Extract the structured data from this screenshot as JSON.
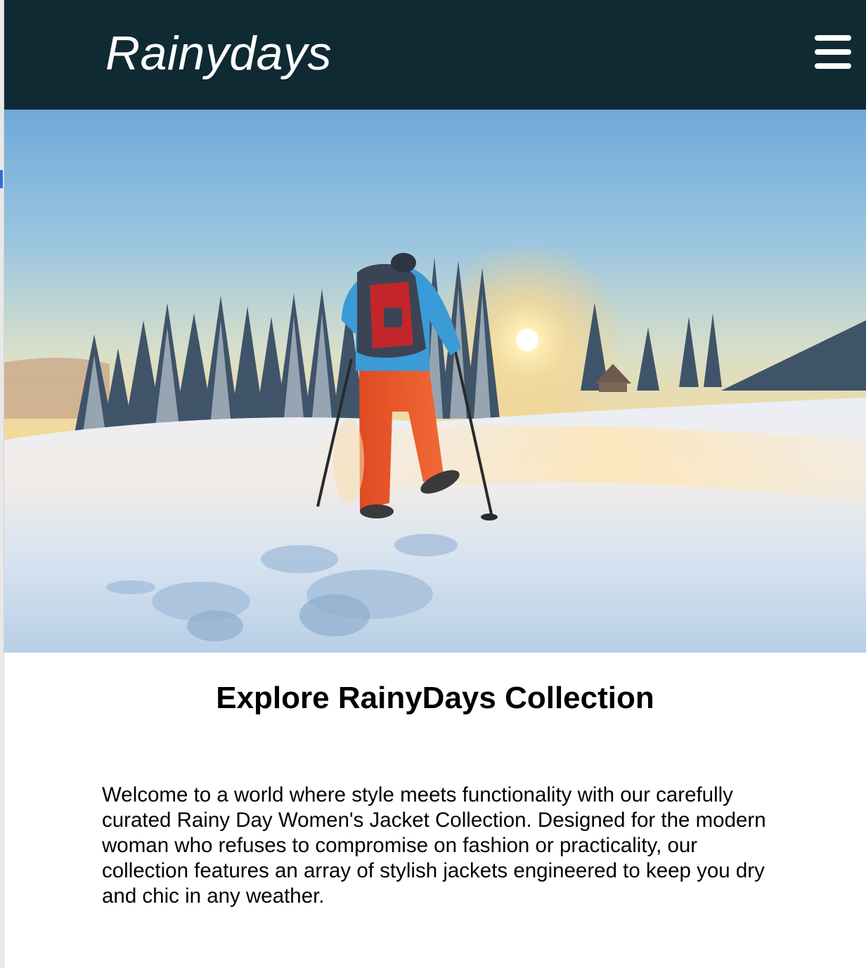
{
  "header": {
    "logo_text": "Rainydays",
    "menu_icon": "hamburger-menu-icon",
    "background_color": "#0f2a33"
  },
  "hero": {
    "subject": "snowshoe-hiker-photo"
  },
  "main": {
    "heading": "Explore RainyDays Collection",
    "intro": "Welcome to a world where style meets functionality with our carefully curated Rainy Day Women's Jacket Collection. Designed for the modern woman who refuses to compromise on fashion or practicality, our collection features an array of stylish jackets engineered to keep you dry and chic in any weather."
  }
}
